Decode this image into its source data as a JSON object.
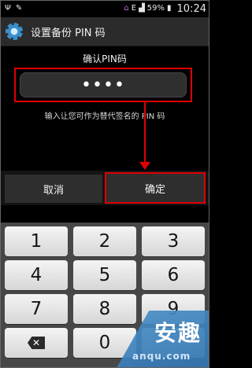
{
  "status_bar": {
    "time": "10:24",
    "battery": "59%",
    "network": "E",
    "icons": [
      "usb-icon",
      "pen-icon",
      "home-icon",
      "signal-icon",
      "battery-icon"
    ]
  },
  "title_bar": {
    "icon": "settings-gear-icon",
    "title": "设置备份 PIN 码"
  },
  "pin_entry": {
    "prompt": "确认PIN码",
    "masked_value": "••••",
    "hint": "输入让您可作为替代签名的 PIN 码"
  },
  "buttons": {
    "cancel": "取消",
    "confirm": "确定"
  },
  "keyboard": {
    "keys": [
      "1",
      "2",
      "3",
      "4",
      "5",
      "6",
      "7",
      "8",
      "9",
      "",
      "0",
      ""
    ],
    "delete_icon": "backspace-icon"
  },
  "watermark": {
    "big": "安趣",
    "small": "anqu.com"
  },
  "colors": {
    "highlight": "#e00000",
    "title_icon": "#3a8fcd"
  }
}
